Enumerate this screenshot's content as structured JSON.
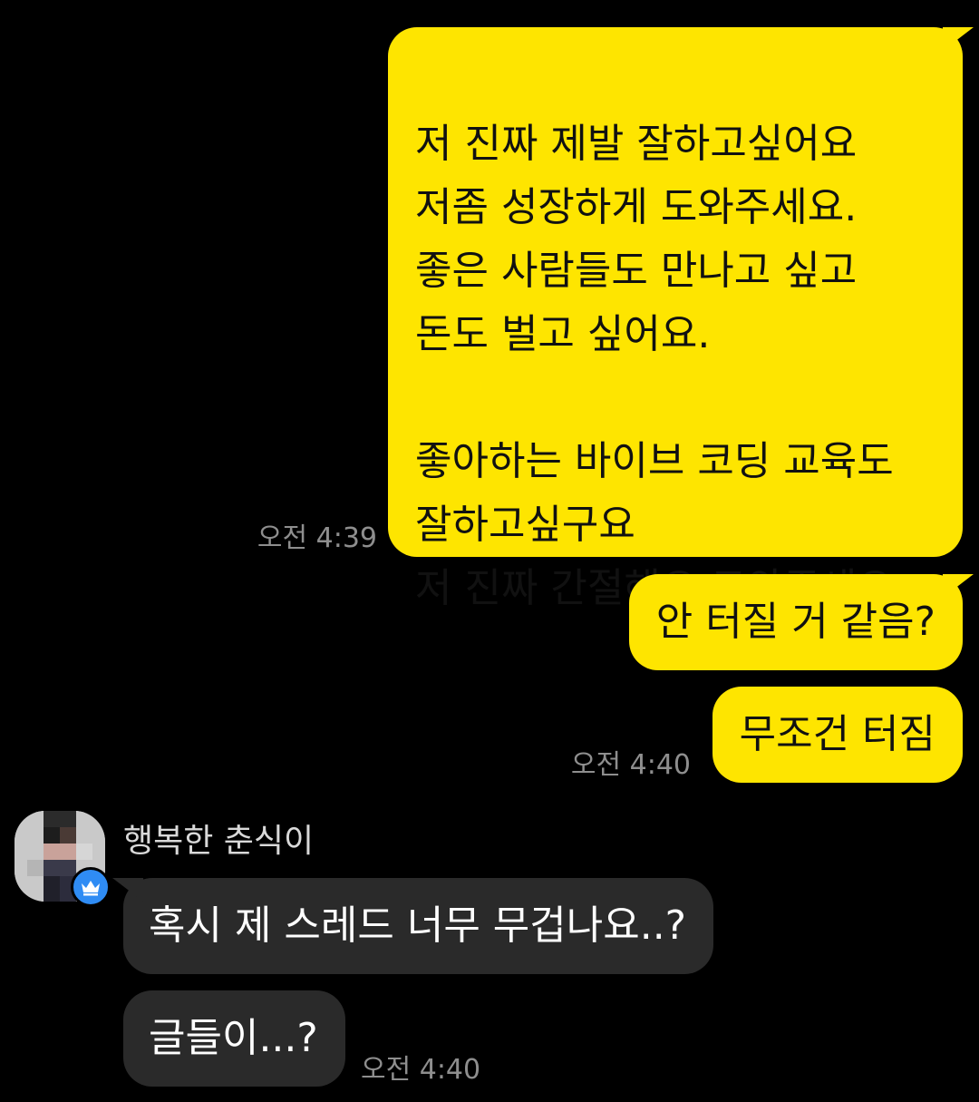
{
  "messages": {
    "m1": {
      "text": "저 진짜 제발 잘하고싶어요\n저좀 성장하게 도와주세요.\n좋은 사람들도 만나고 싶고\n돈도 벌고 싶어요.\n\n좋아하는 바이브 코딩 교육도\n잘하고싶구요\n저 진짜 간절해요 도와주세요",
      "time": "오전 4:39"
    },
    "m2": {
      "text": "안 터질 거 같음?"
    },
    "m3": {
      "text": "무조건 터짐",
      "time": "오전 4:40"
    },
    "m4": {
      "sender": "행복한 춘식이",
      "text": "혹시 제 스레드 너무 무겁나요..?"
    },
    "m5": {
      "text": "글들이...?",
      "time": "오전 4:40"
    }
  },
  "icons": {
    "avatar": "pixelated-avatar",
    "badge": "crown-icon"
  },
  "colors": {
    "background": "#000000",
    "my_bubble": "#FEE500",
    "their_bubble": "#2A2A2A",
    "badge": "#2F8CF4",
    "timestamp": "#8E8E8E"
  }
}
